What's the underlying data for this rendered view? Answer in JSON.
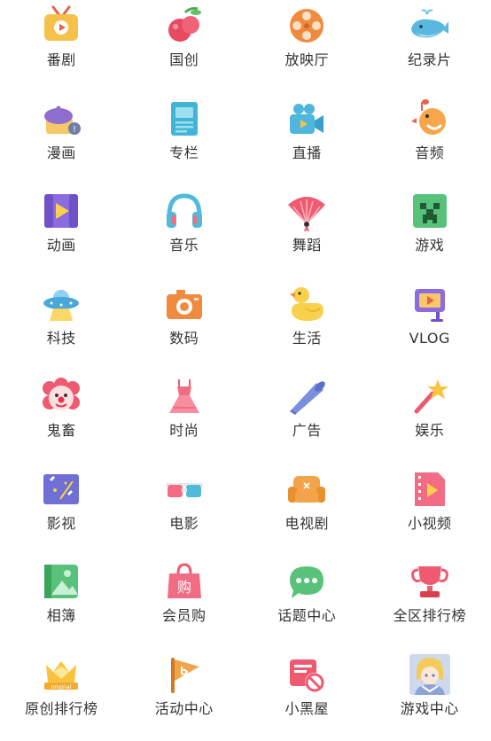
{
  "items": [
    {
      "label": "番剧",
      "icon": "tv-icon"
    },
    {
      "label": "国创",
      "icon": "cherry-icon"
    },
    {
      "label": "放映厅",
      "icon": "film-reel-icon"
    },
    {
      "label": "纪录片",
      "icon": "whale-icon"
    },
    {
      "label": "漫画",
      "icon": "beret-book-icon"
    },
    {
      "label": "专栏",
      "icon": "article-icon"
    },
    {
      "label": "直播",
      "icon": "camera-icon"
    },
    {
      "label": "音频",
      "icon": "bird-icon"
    },
    {
      "label": "动画",
      "icon": "animation-play-icon"
    },
    {
      "label": "音乐",
      "icon": "headphones-icon"
    },
    {
      "label": "舞蹈",
      "icon": "fan-icon"
    },
    {
      "label": "游戏",
      "icon": "creeper-icon"
    },
    {
      "label": "科技",
      "icon": "ufo-icon"
    },
    {
      "label": "数码",
      "icon": "digital-camera-icon"
    },
    {
      "label": "生活",
      "icon": "rubber-duck-icon"
    },
    {
      "label": "VLOG",
      "icon": "vlog-icon"
    },
    {
      "label": "鬼畜",
      "icon": "clown-icon"
    },
    {
      "label": "时尚",
      "icon": "dress-icon"
    },
    {
      "label": "广告",
      "icon": "megaphone-icon"
    },
    {
      "label": "娱乐",
      "icon": "star-wand-icon"
    },
    {
      "label": "影视",
      "icon": "clapper-board-icon"
    },
    {
      "label": "电影",
      "icon": "3d-glasses-icon"
    },
    {
      "label": "电视剧",
      "icon": "sofa-icon"
    },
    {
      "label": "小视频",
      "icon": "video-file-icon"
    },
    {
      "label": "相簿",
      "icon": "photo-album-icon"
    },
    {
      "label": "会员购",
      "icon": "shopping-bag-icon"
    },
    {
      "label": "话题中心",
      "icon": "chat-bubble-icon"
    },
    {
      "label": "全区排行榜",
      "icon": "trophy-icon"
    },
    {
      "label": "原创排行榜",
      "icon": "original-crown-icon"
    },
    {
      "label": "活动中心",
      "icon": "flag-icon"
    },
    {
      "label": "小黑屋",
      "icon": "banned-icon"
    },
    {
      "label": "游戏中心",
      "icon": "game-center-avatar-icon"
    }
  ]
}
